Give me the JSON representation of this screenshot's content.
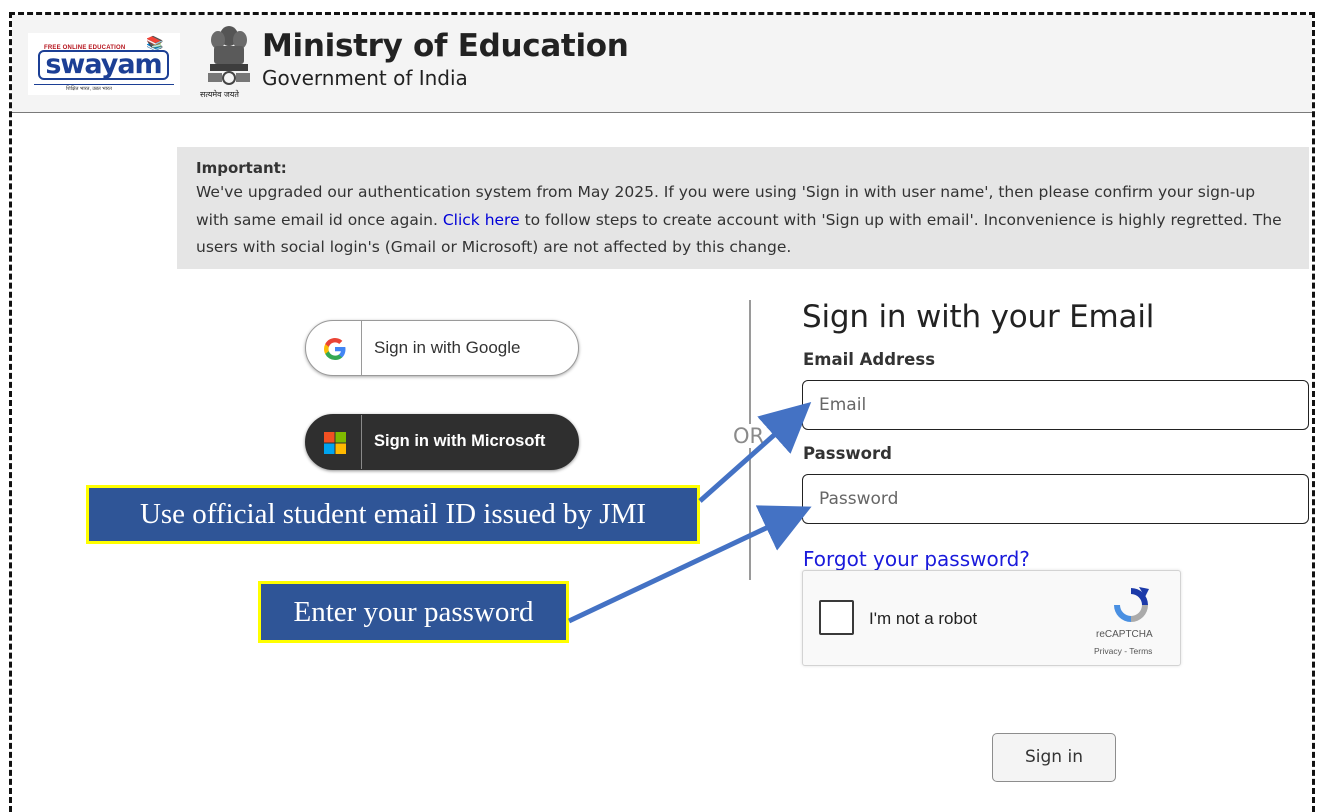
{
  "header": {
    "logo": {
      "name": "swayam",
      "tagline": "FREE ONLINE EDUCATION",
      "motto": "शिक्षित भारत, उन्नत भारत"
    },
    "emblem_caption": "सत्यमेव जयते",
    "ministry_title": "Ministry of Education",
    "ministry_subtitle": "Government of India"
  },
  "notice": {
    "title": "Important:",
    "text_before_link": "We've upgraded our authentication system from May 2025. If you were using 'Sign in with user name', then please confirm your sign-up with same email id once again.",
    "link_text": "Click here",
    "text_after_link": "to follow steps to create account with 'Sign up with email'. Inconvenience is highly regretted. The users with social login's (Gmail or Microsoft) are not affected by this change.",
    "link_color": "#0000d8"
  },
  "social": {
    "google_label": "Sign in with Google",
    "microsoft_label": "Sign in with Microsoft",
    "google_icon": "google-g-icon",
    "microsoft_icon": "microsoft-logo-icon",
    "divider_label": "OR"
  },
  "email_form": {
    "title": "Sign in with your Email",
    "email_label": "Email Address",
    "email_placeholder": "Email",
    "email_value": "",
    "password_label": "Password",
    "password_placeholder": "Password",
    "password_value": "",
    "forgot_link": "Forgot your password?",
    "submit_label": "Sign in"
  },
  "recaptcha": {
    "checkbox_label": "I'm not a robot",
    "checked": false,
    "brand": "reCAPTCHA",
    "terms": "Privacy - Terms"
  },
  "annotations": {
    "email_callout": "Use official student email ID issued by JMI",
    "password_callout": "Enter your password",
    "callout_fill": "#2f5597",
    "callout_border": "#ffff00",
    "arrow_color": "#4472c4"
  }
}
